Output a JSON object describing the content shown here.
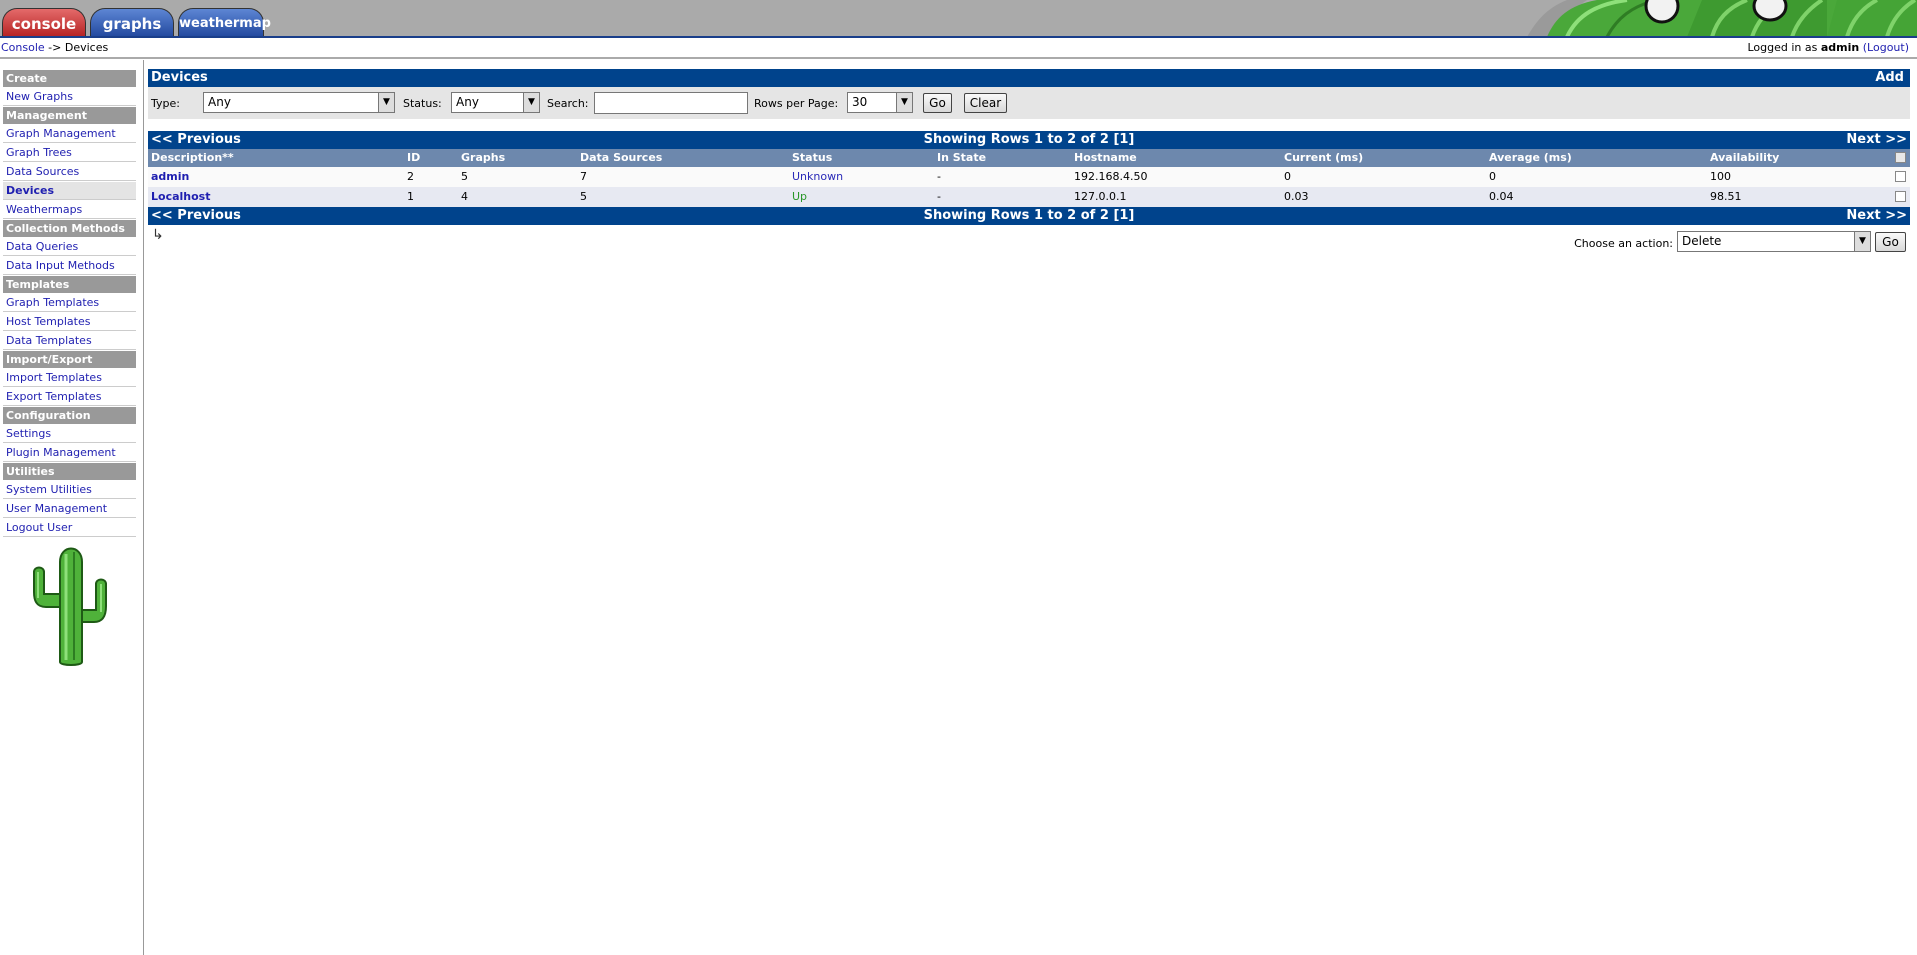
{
  "tabs": [
    {
      "label": "console"
    },
    {
      "label": "graphs"
    },
    {
      "label": "weathermap"
    }
  ],
  "breadcrumb": {
    "root": "Console",
    "separator": "->",
    "current": "Devices"
  },
  "login": {
    "prefix": "Logged in as",
    "user": "admin",
    "logout": "(Logout)"
  },
  "sidebar": {
    "sections": [
      {
        "title": "Create",
        "items": [
          "New Graphs"
        ]
      },
      {
        "title": "Management",
        "items": [
          "Graph Management",
          "Graph Trees",
          "Data Sources",
          "Devices",
          "Weathermaps"
        ]
      },
      {
        "title": "Collection Methods",
        "items": [
          "Data Queries",
          "Data Input Methods"
        ]
      },
      {
        "title": "Templates",
        "items": [
          "Graph Templates",
          "Host Templates",
          "Data Templates"
        ]
      },
      {
        "title": "Import/Export",
        "items": [
          "Import Templates",
          "Export Templates"
        ]
      },
      {
        "title": "Configuration",
        "items": [
          "Settings",
          "Plugin Management"
        ]
      },
      {
        "title": "Utilities",
        "items": [
          "System Utilities",
          "User Management",
          "Logout User"
        ]
      }
    ],
    "active_item": "Devices"
  },
  "panel": {
    "title": "Devices",
    "add": "Add"
  },
  "filters": {
    "type_label": "Type:",
    "type_value": "Any",
    "status_label": "Status:",
    "status_value": "Any",
    "search_label": "Search:",
    "search_value": "",
    "rows_label": "Rows per Page:",
    "rows_value": "30",
    "go": "Go",
    "clear": "Clear"
  },
  "pager": {
    "prev": "<< Previous",
    "next": "Next >>",
    "info": "Showing Rows 1 to 2 of 2 [1]"
  },
  "table": {
    "columns": [
      "Description**",
      "ID",
      "Graphs",
      "Data Sources",
      "Status",
      "In State",
      "Hostname",
      "Current (ms)",
      "Average (ms)",
      "Availability"
    ],
    "rows": [
      {
        "description": "admin",
        "id": "2",
        "graphs": "5",
        "data_sources": "7",
        "status": "Unknown",
        "in_state": "-",
        "hostname": "192.168.4.50",
        "current": "0",
        "average": "0",
        "availability": "100"
      },
      {
        "description": "Localhost",
        "id": "1",
        "graphs": "4",
        "data_sources": "5",
        "status": "Up",
        "in_state": "-",
        "hostname": "127.0.0.1",
        "current": "0.03",
        "average": "0.04",
        "availability": "98.51"
      }
    ]
  },
  "action": {
    "label": "Choose an action:",
    "value": "Delete",
    "go": "Go"
  },
  "colors": {
    "header_blue": "#00438c",
    "column_header": "#6d88ad",
    "status_up": "#289628",
    "status_unknown": "#2a2ab8"
  }
}
